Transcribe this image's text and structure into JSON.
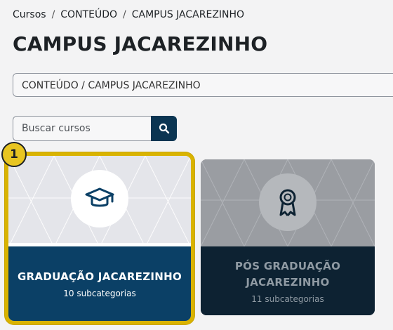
{
  "breadcrumb": {
    "items": [
      "Cursos",
      "CONTEÚDO",
      "CAMPUS JACAREZINHO"
    ],
    "separator": "/"
  },
  "page": {
    "title": "CAMPUS JACAREZINHO"
  },
  "category_select": {
    "value": "CONTEÚDO / CAMPUS JACAREZINHO"
  },
  "search": {
    "placeholder": "Buscar cursos",
    "button_icon": "search-icon"
  },
  "cards": [
    {
      "title": "GRADUAÇÃO JACAREZINHO",
      "subtitle": "10 subcategorias",
      "icon": "graduation-cap-icon",
      "selected": true
    },
    {
      "title": "PÓS GRADUAÇÃO JACAREZINHO",
      "subtitle": "11 subcategorias",
      "icon": "award-ribbon-icon",
      "selected": false
    }
  ],
  "highlight_badge": {
    "label": "1"
  },
  "colors": {
    "primary": "#0b4066",
    "search_button": "#0b3552",
    "highlight": "#e8c521",
    "background": "#f3f3f4"
  }
}
